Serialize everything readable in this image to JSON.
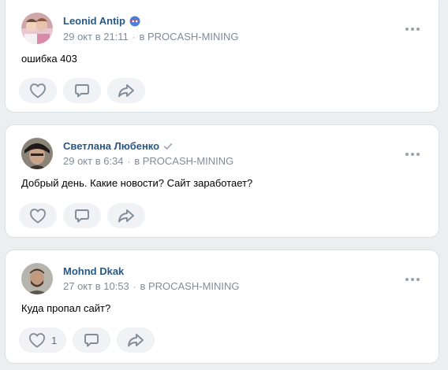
{
  "posts": [
    {
      "author": "Leonid Antip",
      "date": "29 окт в 21:11",
      "group": "в PROCASH-MINING",
      "text": "ошибка 403",
      "likes": "",
      "author_badge": "mask-badge-icon"
    },
    {
      "author": "Светлана Любенко",
      "date": "29 окт в 6:34",
      "group": "в PROCASH-MINING",
      "text": "Добрый день. Какие новости? Сайт заработает?",
      "likes": "",
      "author_badge": "verified-check-icon"
    },
    {
      "author": "Mohnd Dkak",
      "date": "27 окт в 10:53",
      "group": "в PROCASH-MINING",
      "text": "Куда пропал сайт?",
      "likes": "1",
      "author_badge": ""
    }
  ],
  "meta_separator": "·",
  "colors": {
    "background": "#edeef0",
    "card": "#ffffff",
    "link": "#2a5885",
    "secondary": "#818c99",
    "action_bg": "#f0f2f5",
    "icon": "#818c99"
  }
}
